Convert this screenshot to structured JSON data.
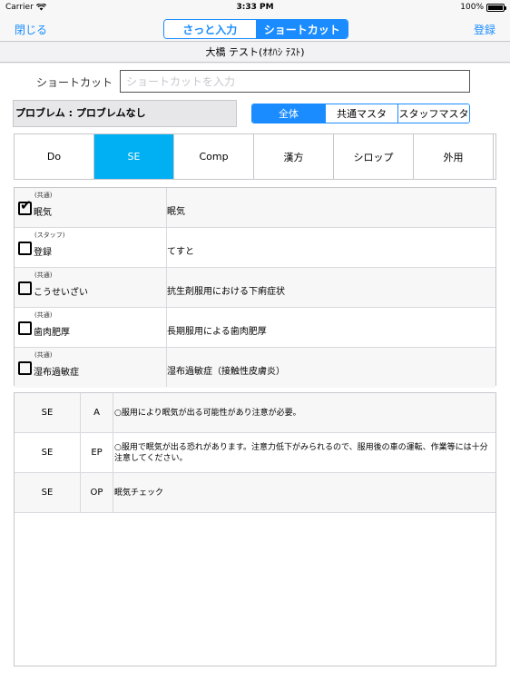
{
  "status": {
    "carrier": "Carrier",
    "time": "3:33 PM",
    "battery": "100%",
    "battery_level": 1.0
  },
  "nav": {
    "close": "閉じる",
    "register": "登録",
    "modes": [
      "さっと入力",
      "ショートカット"
    ],
    "active_mode": 1
  },
  "patient": {
    "name": "大橋 テスト(ｵｵﾊｼ ﾃｽﾄ)"
  },
  "shortcut": {
    "label": "ショートカット",
    "value": "",
    "placeholder": "ショートカットを入力"
  },
  "problem": {
    "text": "プロブレム : プロブレムなし"
  },
  "filter": {
    "options": [
      "全体",
      "共通マスタ",
      "スタッフマスタ"
    ],
    "active": 0
  },
  "categories": {
    "tabs": [
      "Do",
      "SE",
      "Comp",
      "漢方",
      "シロップ",
      "外用"
    ],
    "active": 1
  },
  "shortcuts": [
    {
      "type": "(共通)",
      "name": "眠気",
      "desc": "眠気",
      "checked": true
    },
    {
      "type": "(スタッフ)",
      "name": "登録",
      "desc": "てすと",
      "checked": false
    },
    {
      "type": "(共通)",
      "name": "こうせいざい",
      "desc": "抗生剤服用における下痢症状",
      "checked": false
    },
    {
      "type": "(共通)",
      "name": "歯肉肥厚",
      "desc": "長期服用による歯肉肥厚",
      "checked": false
    },
    {
      "type": "(共通)",
      "name": "湿布過敏症",
      "desc": "湿布過敏症（接触性皮膚炎）",
      "checked": false
    }
  ],
  "details": [
    {
      "cat": "SE",
      "code": "A",
      "text": "○服用により眠気が出る可能性があり注意が必要。"
    },
    {
      "cat": "SE",
      "code": "EP",
      "text": "○服用で眠気が出る恐れがあります。注意力低下がみられるので、服用後の車の運転、作業等には十分注意してください。"
    },
    {
      "cat": "SE",
      "code": "OP",
      "text": "眠気チェック"
    }
  ],
  "colors": {
    "accent": "#1a8cff",
    "tab_active": "#00b0f2"
  }
}
